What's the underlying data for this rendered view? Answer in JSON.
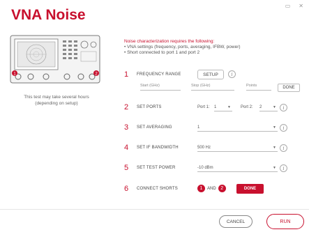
{
  "window": {
    "minimize_glyph": "▭",
    "close_glyph": "✕"
  },
  "title": "VNA Noise",
  "caption_line1": "This test may take several hours",
  "caption_line2": "(depending on setup)",
  "device_badges": [
    "1",
    "2"
  ],
  "info": {
    "heading": "Noise characterization requires the following:",
    "line1": "• VNA settings (frequency, ports, averaging, IFBW, power)",
    "line2": "• Short connected to port 1 and port 2"
  },
  "steps": [
    {
      "num": "1",
      "label": "FREQUENCY RANGE"
    },
    {
      "num": "2",
      "label": "SET PORTS"
    },
    {
      "num": "3",
      "label": "SET AVERAGING"
    },
    {
      "num": "4",
      "label": "SET IF BANDWIDTH"
    },
    {
      "num": "5",
      "label": "SET TEST POWER"
    },
    {
      "num": "6",
      "label": "CONNECT SHORTS"
    }
  ],
  "setup_label": "SETUP",
  "info_glyph": "i",
  "freq_fields": {
    "start": "Start (GHz)",
    "stop": "Stop (GHz)",
    "points": "Points"
  },
  "done_label_light": "DONE",
  "ports": {
    "port1_label": "Port 1:",
    "port1_value": "1",
    "port2_label": "Port 2:",
    "port2_value": "2"
  },
  "averaging_value": "1",
  "ifbw_value": "500 Hz",
  "power_value": "-10 dBm",
  "shorts": {
    "one": "1",
    "and": "AND",
    "two": "2"
  },
  "done_label_red": "DONE",
  "cancel_label": "CANCEL",
  "run_label": "RUN",
  "colors": {
    "accent": "#c8102e"
  }
}
